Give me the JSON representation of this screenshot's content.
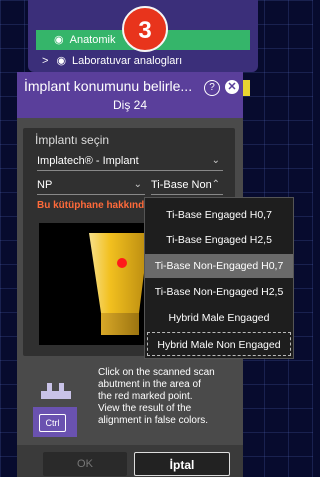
{
  "step_badge": "3",
  "tree": {
    "item1_label": "Anatomik",
    "item2_label": "Laboratuvar analogları",
    "expand_glyph": ">",
    "eye_glyph": "◉"
  },
  "dialog": {
    "title": "İmplant konumunu belirle...",
    "subtitle": "Diş 24",
    "help_glyph": "?",
    "close_glyph": "✕"
  },
  "selection": {
    "section_label": "İmplantı seçin",
    "library_value": "Implatech® - Implant",
    "platform_value": "NP",
    "type_value": "Ti-Base Non",
    "warning_text": "Bu kütüphane hakkında"
  },
  "dropdown": {
    "options": [
      "Ti-Base Engaged H0,7",
      "Ti-Base Engaged H2,5",
      "Ti-Base Non-Engaged H0,7",
      "Ti-Base Non-Engaged H2,5",
      "Hybrid Male Engaged",
      "Hybrid Male Non Engaged"
    ],
    "highlighted_index": 2,
    "focused_index": 5
  },
  "instructions": {
    "text1": "Click on the scanned scan abutment in the area of the red marked point.",
    "text2": "View the result of the alignment in false colors.",
    "ctrl_key": "Ctrl"
  },
  "buttons": {
    "ok": "OK",
    "cancel": "İptal"
  },
  "colors": {
    "accent_purple": "#5a3f9b",
    "tree_green": "#35b56a",
    "badge_red": "#e8341c",
    "warning_orange": "#ff6a3a",
    "abutment_yellow": "#f2c01f"
  }
}
